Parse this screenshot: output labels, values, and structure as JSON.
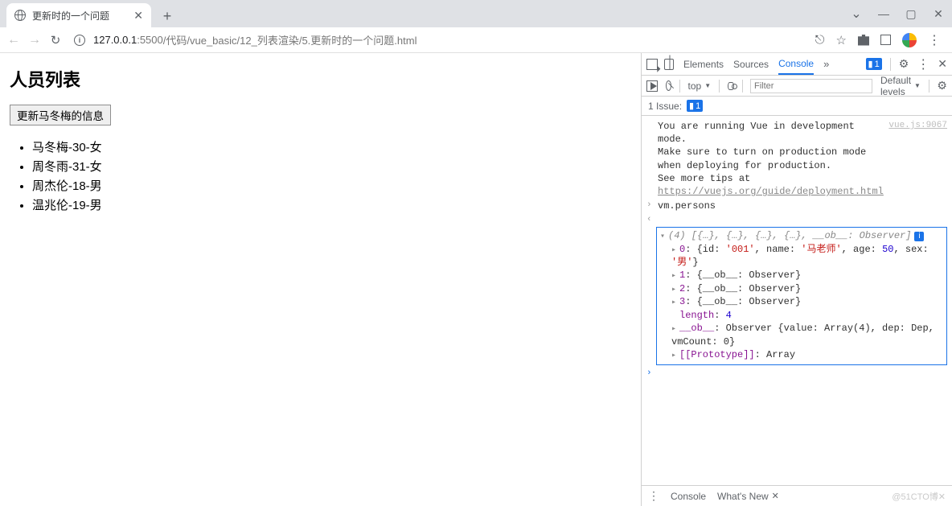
{
  "browser": {
    "tab_title": "更新时的一个问题",
    "url_host": "127.0.0.1",
    "url_port": ":5500",
    "url_path": "/代码/vue_basic/12_列表渲染/5.更新时的一个问题.html",
    "win_min": "—",
    "win_max": "▢",
    "win_close": "✕"
  },
  "page": {
    "heading": "人员列表",
    "update_btn": "更新马冬梅的信息",
    "persons": [
      "马冬梅-30-女",
      "周冬雨-31-女",
      "周杰伦-18-男",
      "温兆伦-19-男"
    ]
  },
  "devtools": {
    "tabs": {
      "elements": "Elements",
      "sources": "Sources",
      "console": "Console",
      "more": "»"
    },
    "badge_count": "1",
    "kebab": "⋮",
    "close": "✕",
    "subbar": {
      "context": "top",
      "filter_placeholder": "Filter",
      "levels": "Default levels"
    },
    "issue_bar": {
      "label": "1 Issue:",
      "count": "1"
    },
    "console_msgs": {
      "vue_dev1": "You are running Vue in development mode.",
      "vue_dev2": "Make sure to turn on production mode when deploying for production.",
      "vue_dev3": "See more tips at ",
      "vue_dev_link": "https://vuejs.org/guide/deployment.html",
      "vue_src": "vue.js:9067",
      "input_cmd": "vm.persons",
      "summary_pre": "(4) [",
      "summary_items": "{…}, {…}, {…}, {…}, ",
      "summary_ob": "__ob__: Observer",
      "summary_post": "]",
      "idx0_pre": "0: ",
      "idx0_body": "{id: '001', name: '马老师', age: 50, sex: '男'}",
      "idx0_id": "'001'",
      "idx0_name": "'马老师'",
      "idx0_age": "50",
      "idx0_sex": "'男'",
      "idx1": "1: {__ob__: Observer}",
      "idx2": "2: {__ob__: Observer}",
      "idx3": "3: {__ob__: Observer}",
      "length_label": "length",
      "length_val": "4",
      "ob_label": "__ob__",
      "ob_val": "Observer {value: Array(4), dep: Dep, vmCount: 0}",
      "proto_label": "[[Prototype]]",
      "proto_val": "Array"
    },
    "drawer": {
      "console": "Console",
      "whatsnew": "What's New",
      "watermark": "@51CTO博✕"
    }
  },
  "glyphs": {
    "chev_down": "⌄",
    "share": "⇪",
    "star": "☆",
    "plus": "+",
    "reload": "↻",
    "back": "←",
    "fwd": "→",
    "eye": "eye",
    "tri_right": "▸",
    "tri_down": "▾",
    "gear": "⚙"
  }
}
